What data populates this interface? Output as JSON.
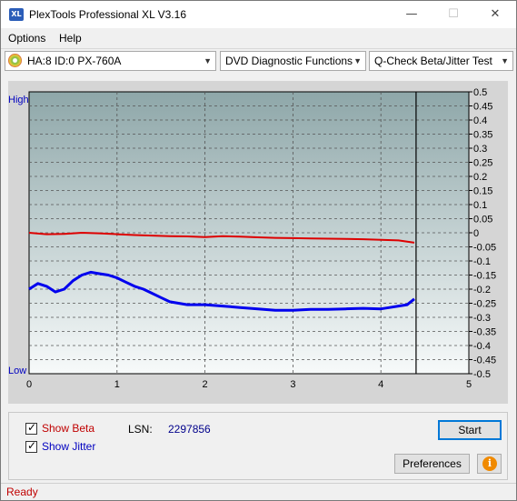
{
  "window": {
    "title": "PlexTools Professional XL V3.16",
    "icon_text": "XL"
  },
  "title_buttons": {
    "minimize": "—",
    "maximize": "☐",
    "close": "✕"
  },
  "menu": {
    "options": "Options",
    "help": "Help"
  },
  "toolbar": {
    "drive": "HA:8 ID:0  PX-760A",
    "function": "DVD Diagnostic Functions",
    "test": "Q-Check Beta/Jitter Test"
  },
  "chart_data": {
    "type": "line",
    "y_left_labels": {
      "top": "High",
      "bottom": "Low"
    },
    "x_ticks": [
      "0",
      "1",
      "2",
      "3",
      "4",
      "5"
    ],
    "xlim": [
      0,
      5
    ],
    "ylim": [
      -0.5,
      0.5
    ],
    "y_ticks": [
      "0.5",
      "0.45",
      "0.4",
      "0.35",
      "0.3",
      "0.25",
      "0.2",
      "0.15",
      "0.1",
      "0.05",
      "0",
      "-0.05",
      "-0.1",
      "-0.15",
      "-0.2",
      "-0.25",
      "-0.3",
      "-0.35",
      "-0.4",
      "-0.45",
      "-0.5"
    ],
    "grid": true,
    "end_marker_x": 4.4,
    "series": [
      {
        "name": "Beta",
        "color": "#dd0000",
        "x": [
          0,
          0.2,
          0.4,
          0.6,
          0.8,
          1.0,
          1.2,
          1.4,
          1.6,
          1.8,
          2.0,
          2.2,
          2.4,
          2.6,
          2.8,
          3.0,
          3.2,
          3.4,
          3.6,
          3.8,
          4.0,
          4.2,
          4.38
        ],
        "y": [
          0.0,
          -0.005,
          -0.004,
          0.0,
          -0.002,
          -0.005,
          -0.008,
          -0.01,
          -0.012,
          -0.013,
          -0.015,
          -0.012,
          -0.014,
          -0.016,
          -0.018,
          -0.019,
          -0.02,
          -0.021,
          -0.022,
          -0.023,
          -0.025,
          -0.027,
          -0.035
        ]
      },
      {
        "name": "Jitter",
        "color": "#0000ee",
        "x": [
          0,
          0.1,
          0.2,
          0.3,
          0.4,
          0.5,
          0.6,
          0.7,
          0.8,
          0.9,
          1.0,
          1.1,
          1.2,
          1.3,
          1.4,
          1.5,
          1.6,
          1.8,
          2.0,
          2.2,
          2.4,
          2.6,
          2.8,
          3.0,
          3.2,
          3.4,
          3.6,
          3.8,
          4.0,
          4.1,
          4.2,
          4.3,
          4.38
        ],
        "y": [
          -0.2,
          -0.18,
          -0.19,
          -0.21,
          -0.2,
          -0.17,
          -0.15,
          -0.14,
          -0.145,
          -0.15,
          -0.16,
          -0.175,
          -0.19,
          -0.2,
          -0.215,
          -0.23,
          -0.245,
          -0.255,
          -0.255,
          -0.26,
          -0.265,
          -0.27,
          -0.275,
          -0.275,
          -0.272,
          -0.272,
          -0.27,
          -0.268,
          -0.27,
          -0.265,
          -0.26,
          -0.255,
          -0.235
        ]
      }
    ]
  },
  "controls": {
    "show_beta": "Show Beta",
    "show_jitter": "Show Jitter",
    "lsn_label": "LSN:",
    "lsn_value": "2297856",
    "start": "Start",
    "preferences": "Preferences",
    "info_icon": "i"
  },
  "status": {
    "text": "Ready"
  }
}
